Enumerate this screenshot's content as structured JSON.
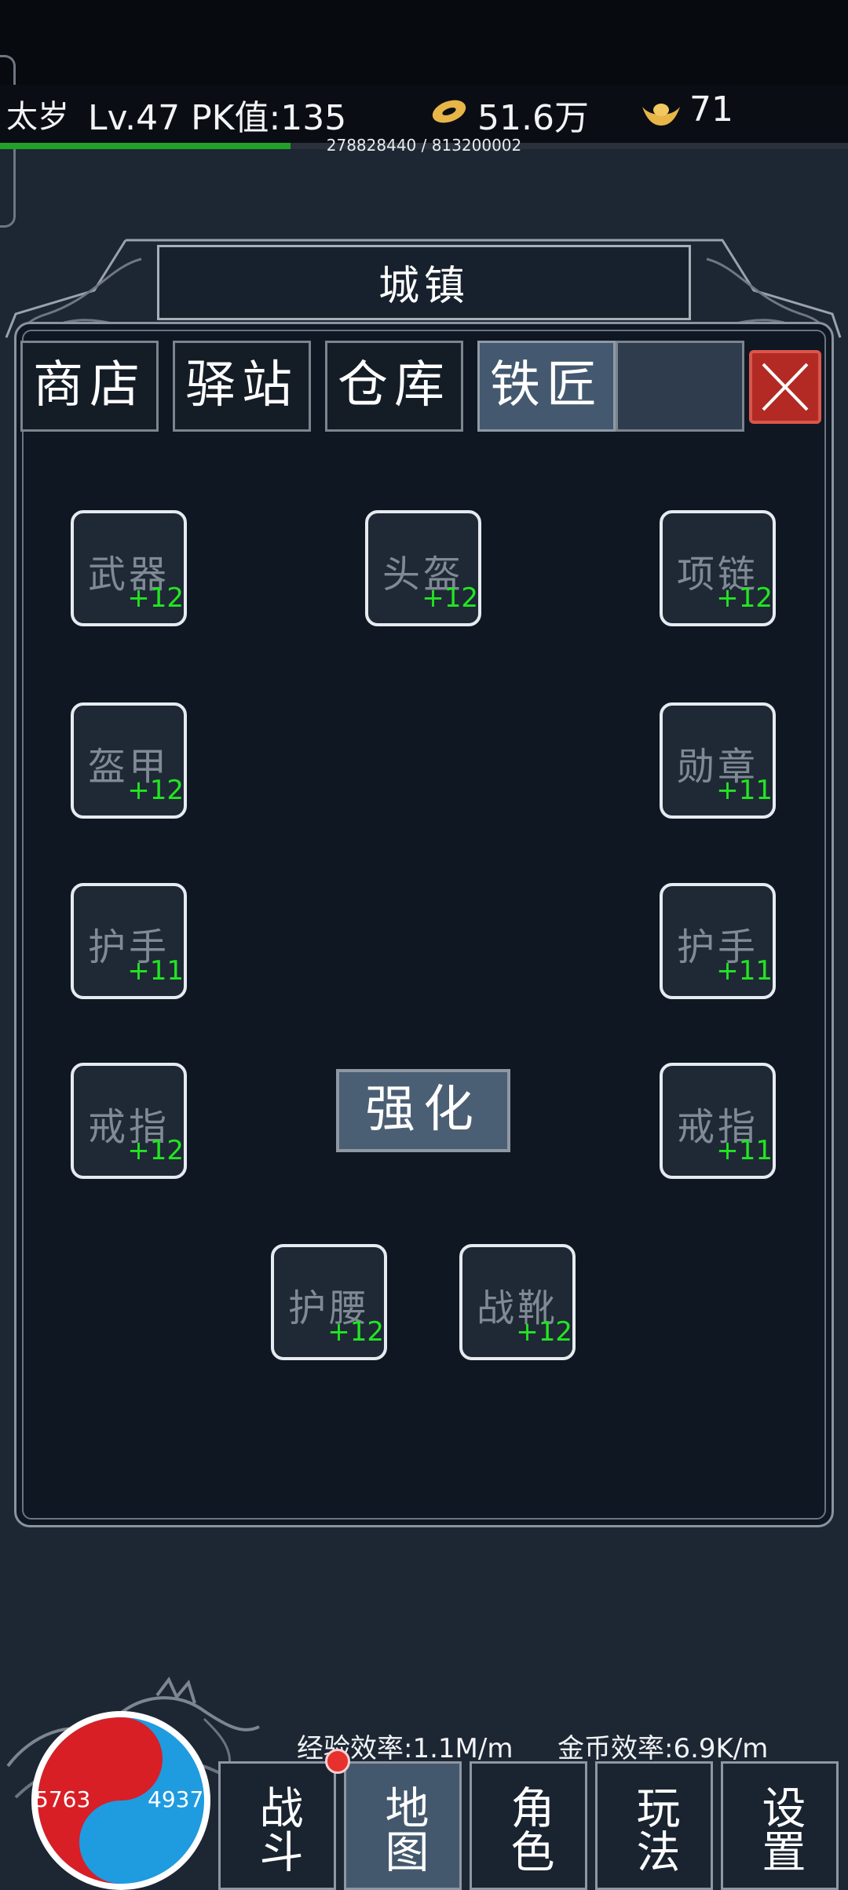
{
  "status": {
    "player_name": "太岁",
    "level_pk": "Lv.47 PK值:135",
    "coins": "51.6万",
    "ingots": "71",
    "exp_text": "278828440 / 813200002",
    "exp_progress": 0.343
  },
  "panel": {
    "title": "城镇",
    "tabs": [
      {
        "label": "商店",
        "active": false
      },
      {
        "label": "驿站",
        "active": false
      },
      {
        "label": "仓库",
        "active": false
      },
      {
        "label": "铁匠",
        "active": true
      }
    ]
  },
  "equipment": [
    {
      "name": "武器",
      "level": "+12"
    },
    {
      "name": "头盔",
      "level": "+12"
    },
    {
      "name": "项链",
      "level": "+12"
    },
    {
      "name": "盔甲",
      "level": "+12"
    },
    {
      "name": "勋章",
      "level": "+11"
    },
    {
      "name": "护手",
      "level": "+11"
    },
    {
      "name": "护手",
      "level": "+11"
    },
    {
      "name": "戒指",
      "level": "+12"
    },
    {
      "name": "戒指",
      "level": "+11"
    },
    {
      "name": "护腰",
      "level": "+12"
    },
    {
      "name": "战靴",
      "level": "+12"
    }
  ],
  "enhance_label": "强化",
  "bottom": {
    "hp": "5763",
    "mp": "4937",
    "exp_rate": "经验效率:1.1M/m",
    "gold_rate": "金币效率:6.9K/m",
    "nav": [
      {
        "label": "战斗",
        "active": false
      },
      {
        "label": "地图",
        "active": true
      },
      {
        "label": "角色",
        "active": false
      },
      {
        "label": "玩法",
        "active": false
      },
      {
        "label": "设置",
        "active": false
      }
    ]
  },
  "colors": {
    "background": "#1d2633",
    "panel": "#0e1722",
    "level_green": "#22e622",
    "exp_bar": "#22a02a",
    "close_red": "#b32a24",
    "hp_red": "#d81f26",
    "mp_blue": "#1f9be0"
  }
}
